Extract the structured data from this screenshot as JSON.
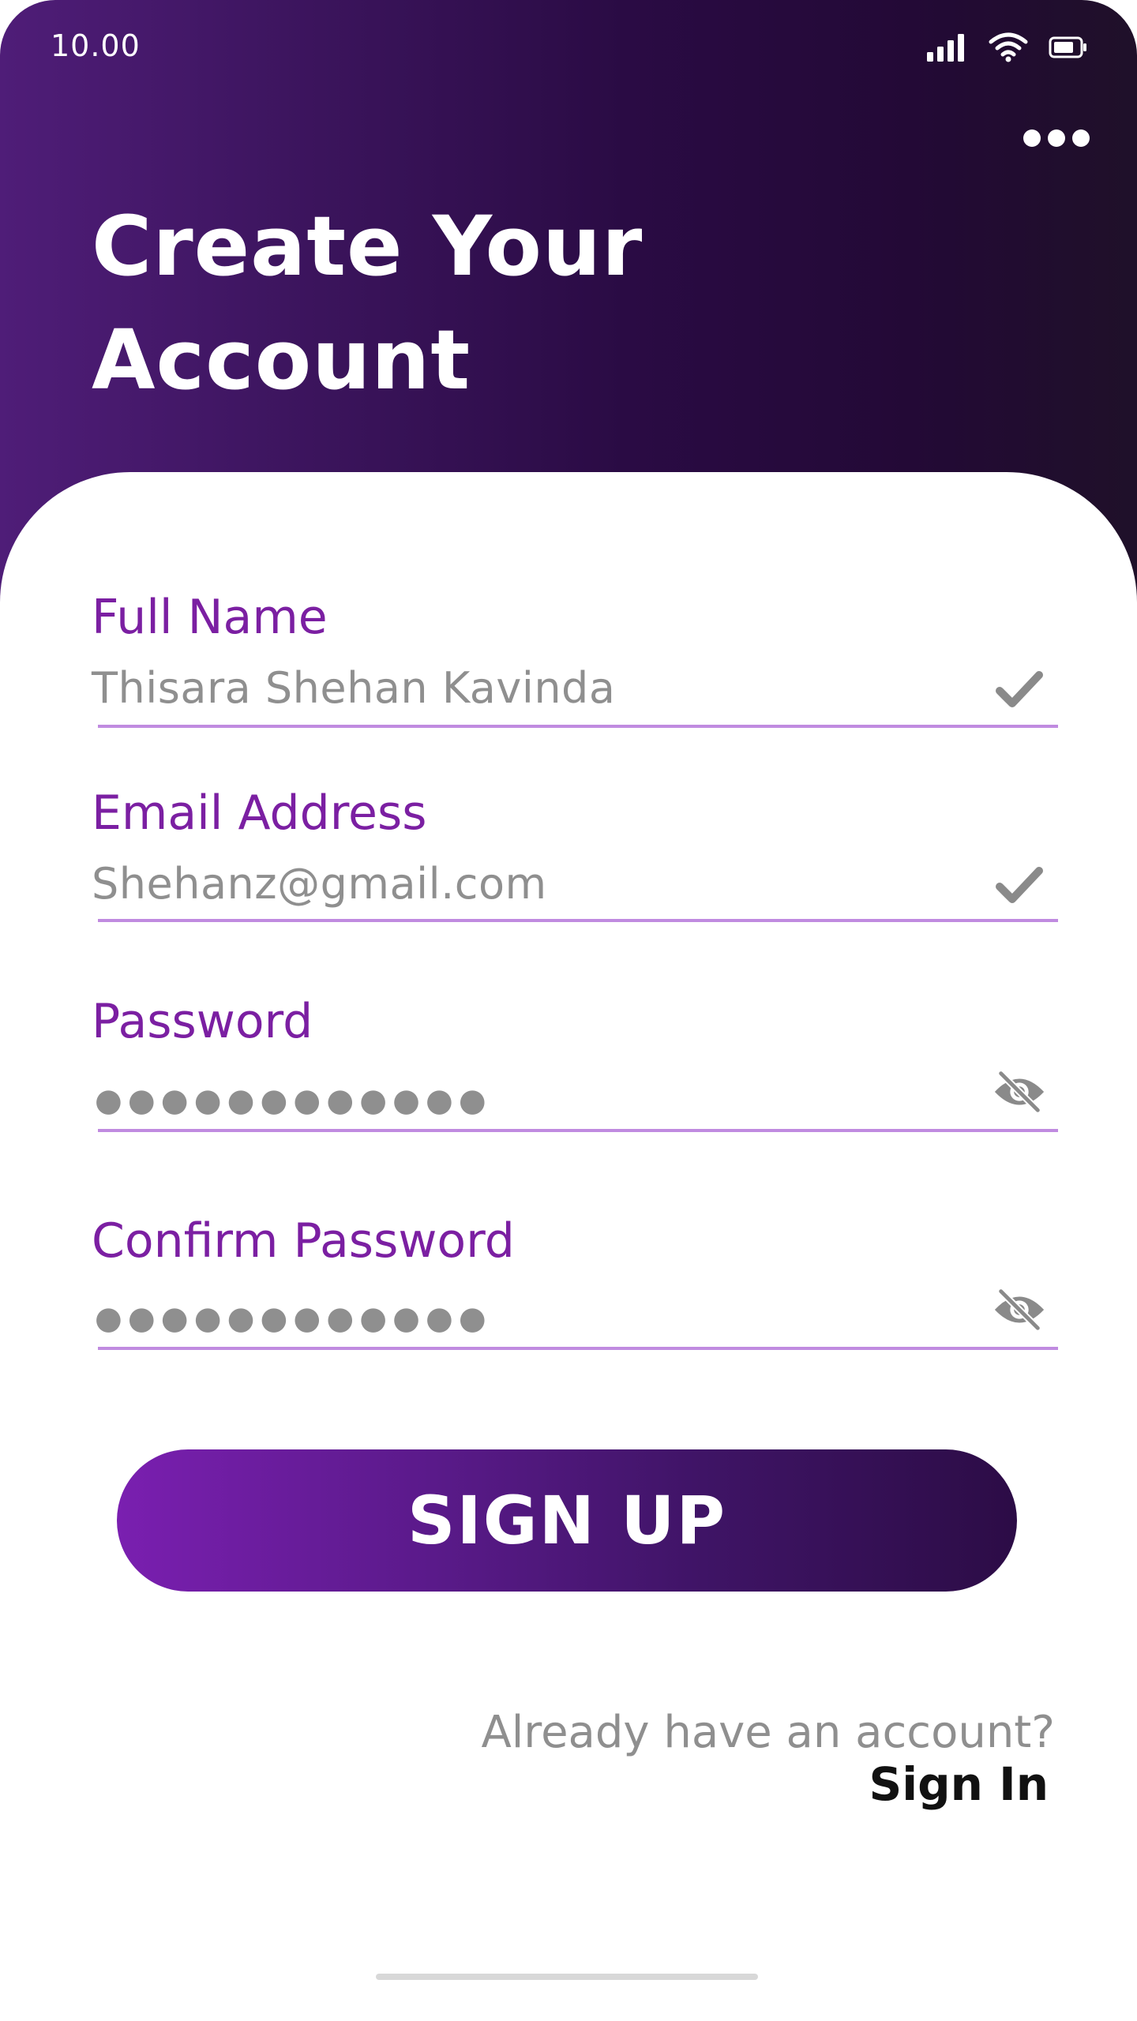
{
  "status_bar": {
    "time": "10.00",
    "icons": [
      "signal-icon",
      "wifi-icon",
      "battery-icon"
    ]
  },
  "header": {
    "menu_icon": "more-horizontal-icon",
    "title_line1": "Create Your",
    "title_line2": "Account"
  },
  "form": {
    "full_name": {
      "label": "Full Name",
      "value": "Thisara Shehan Kavinda",
      "status_icon": "check-icon"
    },
    "email": {
      "label": "Email Address",
      "value": "Shehanz@gmail.com",
      "status_icon": "check-icon"
    },
    "password": {
      "label": "Password",
      "masked_value": "●●●●●●●●●●●●",
      "toggle_icon": "eye-off-icon"
    },
    "confirm_password": {
      "label": "Confirm Password",
      "masked_value": "●●●●●●●●●●●●",
      "toggle_icon": "eye-off-icon"
    }
  },
  "actions": {
    "signup_label": "SIGN UP",
    "already_text": "Already have an account?",
    "signin_label": "Sign In"
  },
  "colors": {
    "accent": "#7b1fa2",
    "underline": "#c08be0",
    "header_gradient_start": "#4f1d78",
    "header_gradient_end": "#1f1029",
    "muted_text": "#8f8f8f"
  }
}
